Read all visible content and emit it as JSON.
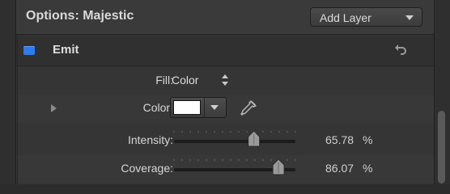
{
  "header": {
    "title": "Options: Majestic",
    "add_layer_label": "Add Layer"
  },
  "emit": {
    "label": "Emit",
    "enabled": true
  },
  "params": {
    "fill": {
      "label": "Fill:",
      "value": "Color"
    },
    "color": {
      "label": "Color:",
      "swatch_color": "#ffffff"
    },
    "intensity": {
      "label": "Intensity:",
      "value": "65.78",
      "unit": "%",
      "level": 0.6578
    },
    "coverage": {
      "label": "Coverage:",
      "value": "86.07",
      "unit": "%",
      "level": 0.8607
    }
  },
  "colors": {
    "accent_blue": "#2c7df0",
    "background": "#2f2f2f"
  },
  "icons": {
    "reset": "reset-arrow-icon",
    "eyedropper": "eyedropper-icon",
    "updown": "updown-arrows-icon",
    "disclosure": "disclosure-triangle-icon",
    "dropdown": "chevron-down-icon"
  }
}
